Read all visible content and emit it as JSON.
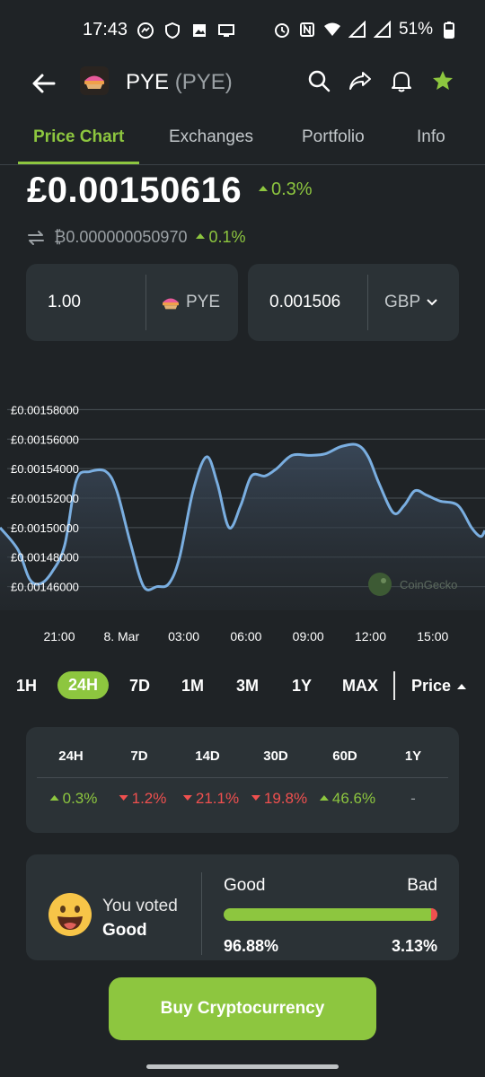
{
  "status": {
    "time": "17:43",
    "battery": "51%"
  },
  "header": {
    "coin_name": "PYE",
    "coin_symbol": "(PYE)"
  },
  "tabs": [
    {
      "label": "Price Chart",
      "active": true
    },
    {
      "label": "Exchanges",
      "active": false
    },
    {
      "label": "Portfolio",
      "active": false
    },
    {
      "label": "Info",
      "active": false
    }
  ],
  "price": {
    "main": "£0.00150616",
    "change": "0.3%",
    "btc_value": "₿0.000000050970",
    "btc_change": "0.1%"
  },
  "converter": {
    "amount": "1.00",
    "amount_unit": "PYE",
    "converted": "0.001506",
    "converted_unit": "GBP"
  },
  "chart_data": {
    "type": "area",
    "yticks": [
      "£0.00158000",
      "£0.00156000",
      "£0.00154000",
      "£0.00152000",
      "£0.00150000",
      "£0.00148000",
      "£0.00146000"
    ],
    "xticks": [
      "21:00",
      "8. Mar",
      "03:00",
      "06:00",
      "09:00",
      "12:00",
      "15:00"
    ],
    "ylim": [
      0.00145,
      0.00159
    ],
    "watermark": "CoinGecko",
    "points": [
      [
        0,
        0.0015
      ],
      [
        20,
        0.001485
      ],
      [
        33,
        0.001465
      ],
      [
        45,
        0.001462
      ],
      [
        58,
        0.00147
      ],
      [
        72,
        0.001488
      ],
      [
        85,
        0.001532
      ],
      [
        100,
        0.001538
      ],
      [
        118,
        0.001538
      ],
      [
        130,
        0.001525
      ],
      [
        145,
        0.00149
      ],
      [
        160,
        0.00146
      ],
      [
        175,
        0.00146
      ],
      [
        188,
        0.001462
      ],
      [
        200,
        0.00148
      ],
      [
        215,
        0.001525
      ],
      [
        230,
        0.001548
      ],
      [
        242,
        0.00153
      ],
      [
        255,
        0.0015
      ],
      [
        268,
        0.001515
      ],
      [
        280,
        0.001535
      ],
      [
        295,
        0.001535
      ],
      [
        308,
        0.00154
      ],
      [
        325,
        0.001549
      ],
      [
        345,
        0.001549
      ],
      [
        362,
        0.00155
      ],
      [
        380,
        0.001555
      ],
      [
        398,
        0.001556
      ],
      [
        410,
        0.001548
      ],
      [
        422,
        0.00153
      ],
      [
        438,
        0.00151
      ],
      [
        450,
        0.001515
      ],
      [
        462,
        0.001525
      ],
      [
        475,
        0.001522
      ],
      [
        490,
        0.001518
      ],
      [
        510,
        0.001515
      ],
      [
        525,
        0.0015
      ],
      [
        535,
        0.001494
      ],
      [
        540,
        0.001498
      ]
    ]
  },
  "ranges": [
    {
      "label": "1H",
      "active": false
    },
    {
      "label": "24H",
      "active": true
    },
    {
      "label": "7D",
      "active": false
    },
    {
      "label": "1M",
      "active": false
    },
    {
      "label": "3M",
      "active": false
    },
    {
      "label": "1Y",
      "active": false
    },
    {
      "label": "MAX",
      "active": false
    }
  ],
  "price_toggle": "Price",
  "performance": [
    {
      "period": "24H",
      "value": "0.3%",
      "dir": "up"
    },
    {
      "period": "7D",
      "value": "1.2%",
      "dir": "down"
    },
    {
      "period": "14D",
      "value": "21.1%",
      "dir": "down"
    },
    {
      "period": "30D",
      "value": "19.8%",
      "dir": "down"
    },
    {
      "period": "60D",
      "value": "46.6%",
      "dir": "up"
    },
    {
      "period": "1Y",
      "value": "-",
      "dir": "na"
    }
  ],
  "vote": {
    "voted_label": "You voted",
    "voted_value": "Good",
    "good_label": "Good",
    "bad_label": "Bad",
    "good_pct": "96.88%",
    "bad_pct": "3.13%",
    "bad_fraction": 0.0313
  },
  "buy_button": "Buy Cryptocurrency",
  "colors": {
    "accent": "#8dc63f",
    "negative": "#f0504f",
    "line": "#7aaee0"
  }
}
